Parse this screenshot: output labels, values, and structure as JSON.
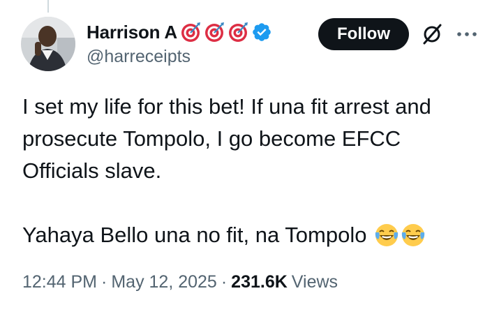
{
  "user": {
    "display_name": "Harrison A",
    "handle": "@harreceipts",
    "name_emojis": [
      "target-icon",
      "target-icon",
      "target-icon"
    ],
    "verified": true
  },
  "actions": {
    "follow_label": "Follow"
  },
  "tweet": {
    "paragraph1": "I set my life for this bet! If una fit arrest and prosecute Tompolo, I go become EFCC Officials slave.",
    "paragraph2": "Yahaya Bello una no fit, na Tompolo",
    "trailing_emojis": [
      "laughing-crying-icon",
      "laughing-crying-icon"
    ]
  },
  "meta": {
    "time": "12:44 PM",
    "separator": "·",
    "date": "May 12, 2025",
    "views_count": "231.6K",
    "views_label": "Views"
  },
  "colors": {
    "text": "#0f1419",
    "secondary": "#536471",
    "verified_blue": "#1d9bf0",
    "follow_bg": "#0f1419"
  }
}
